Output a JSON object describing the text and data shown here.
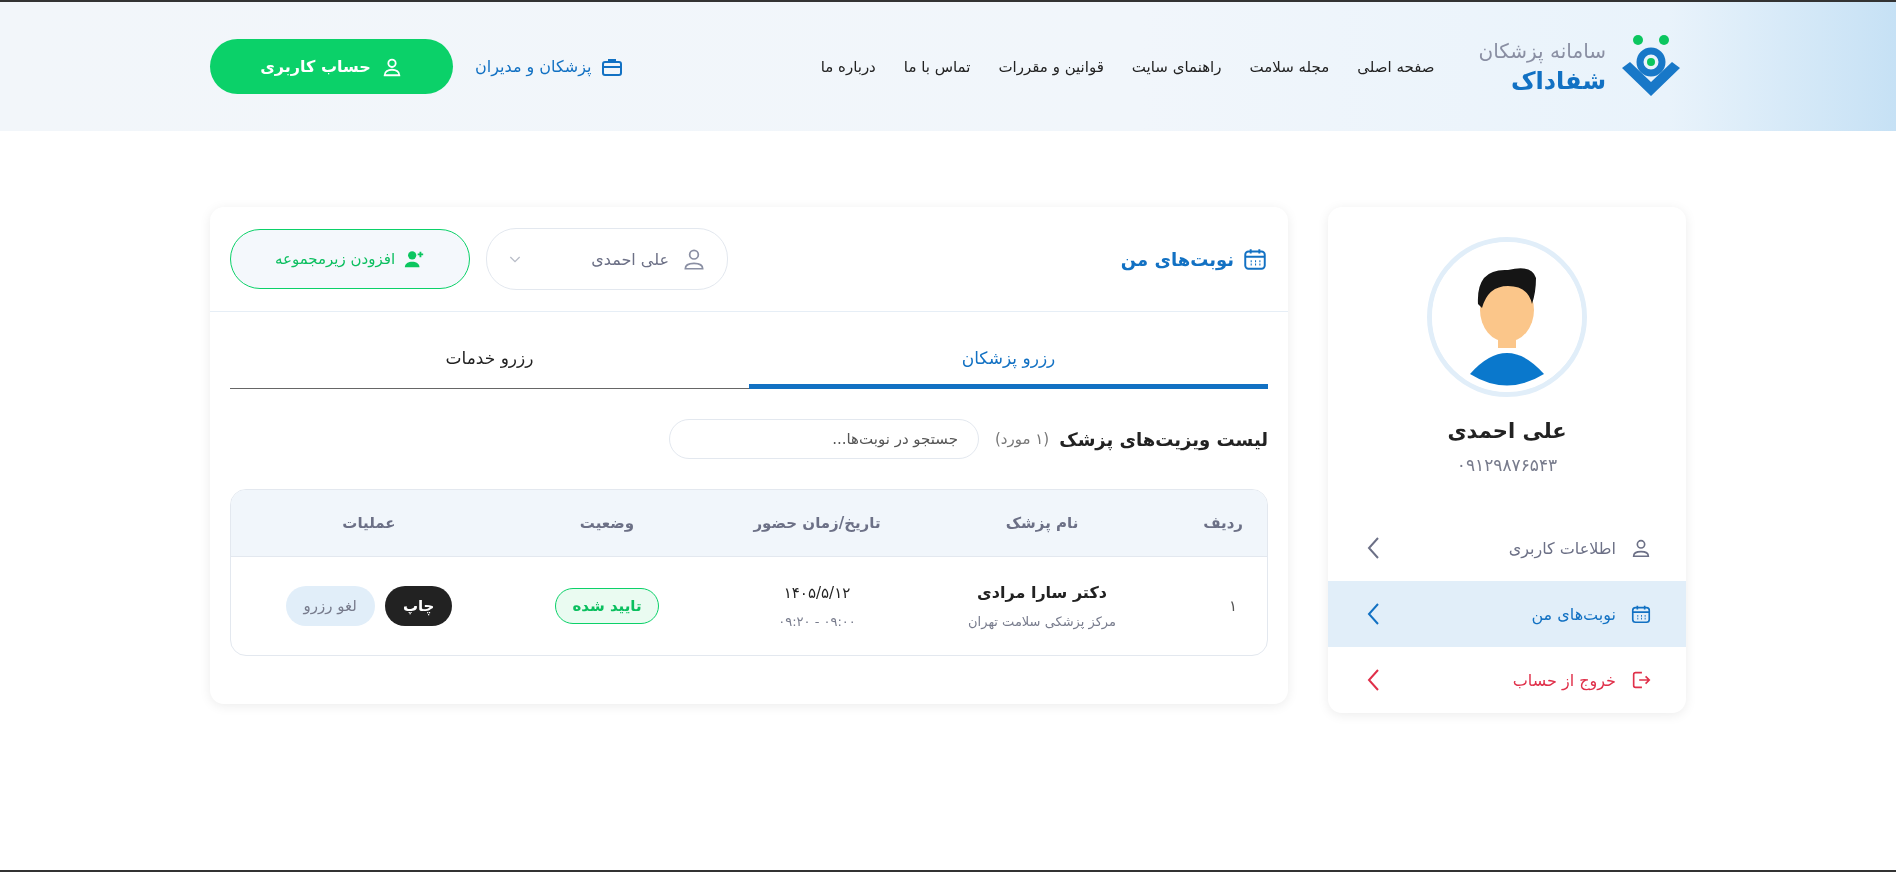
{
  "header": {
    "logo": {
      "subtitle": "سامانه پزشکان",
      "name": "شفاداک"
    },
    "nav": [
      {
        "label": "صفحه اصلی"
      },
      {
        "label": "مجله سلامت"
      },
      {
        "label": "راهنمای سایت"
      },
      {
        "label": "قوانین و مقررات"
      },
      {
        "label": "تماس با ما"
      },
      {
        "label": "درباره ما"
      }
    ],
    "doctors_link": "پزشکان و مدیران",
    "account_button": "حساب کاربری"
  },
  "sidebar": {
    "name": "علی احمدی",
    "phone": "۰۹۱۲۹۸۷۶۵۴۳",
    "items": [
      {
        "kind": "profile",
        "label": "اطلاعات کاربری",
        "selected": false
      },
      {
        "kind": "appointments",
        "label": "نوبت‌های من",
        "selected": true
      },
      {
        "kind": "logout",
        "label": "خروج از حساب",
        "selected": false
      }
    ]
  },
  "panel": {
    "title": "نوبت‌های من",
    "person_select": {
      "value": "علی احمدی"
    },
    "add_button": "افزودن زیرمجموعه",
    "tabs": [
      {
        "label": "رزرو پزشکان",
        "selected": true
      },
      {
        "label": "رزرو خدمات",
        "selected": false
      }
    ],
    "list_title": "لیست ویزیت‌های پزشک",
    "count": "(۱ مورد)",
    "search": {
      "placeholder": "جستجو در نوبت‌ها..."
    },
    "table": {
      "columns": [
        "ردیف",
        "نام پزشک",
        "تاریخ/زمان حضور",
        "وضعیت",
        "عملیات"
      ],
      "rows": [
        {
          "index": "۱",
          "doctor": "دکتر سارا مرادی",
          "clinic": "مرکز پزشکی سلامت تهران",
          "date": "۱۴۰۵/۵/۱۲",
          "time": "۰۹:۰۰ - ۰۹:۲۰",
          "status": {
            "kind": "confirmed",
            "label": "تایید شده"
          },
          "actions": [
            "چاپ",
            "لغو رزرو"
          ]
        }
      ]
    }
  }
}
